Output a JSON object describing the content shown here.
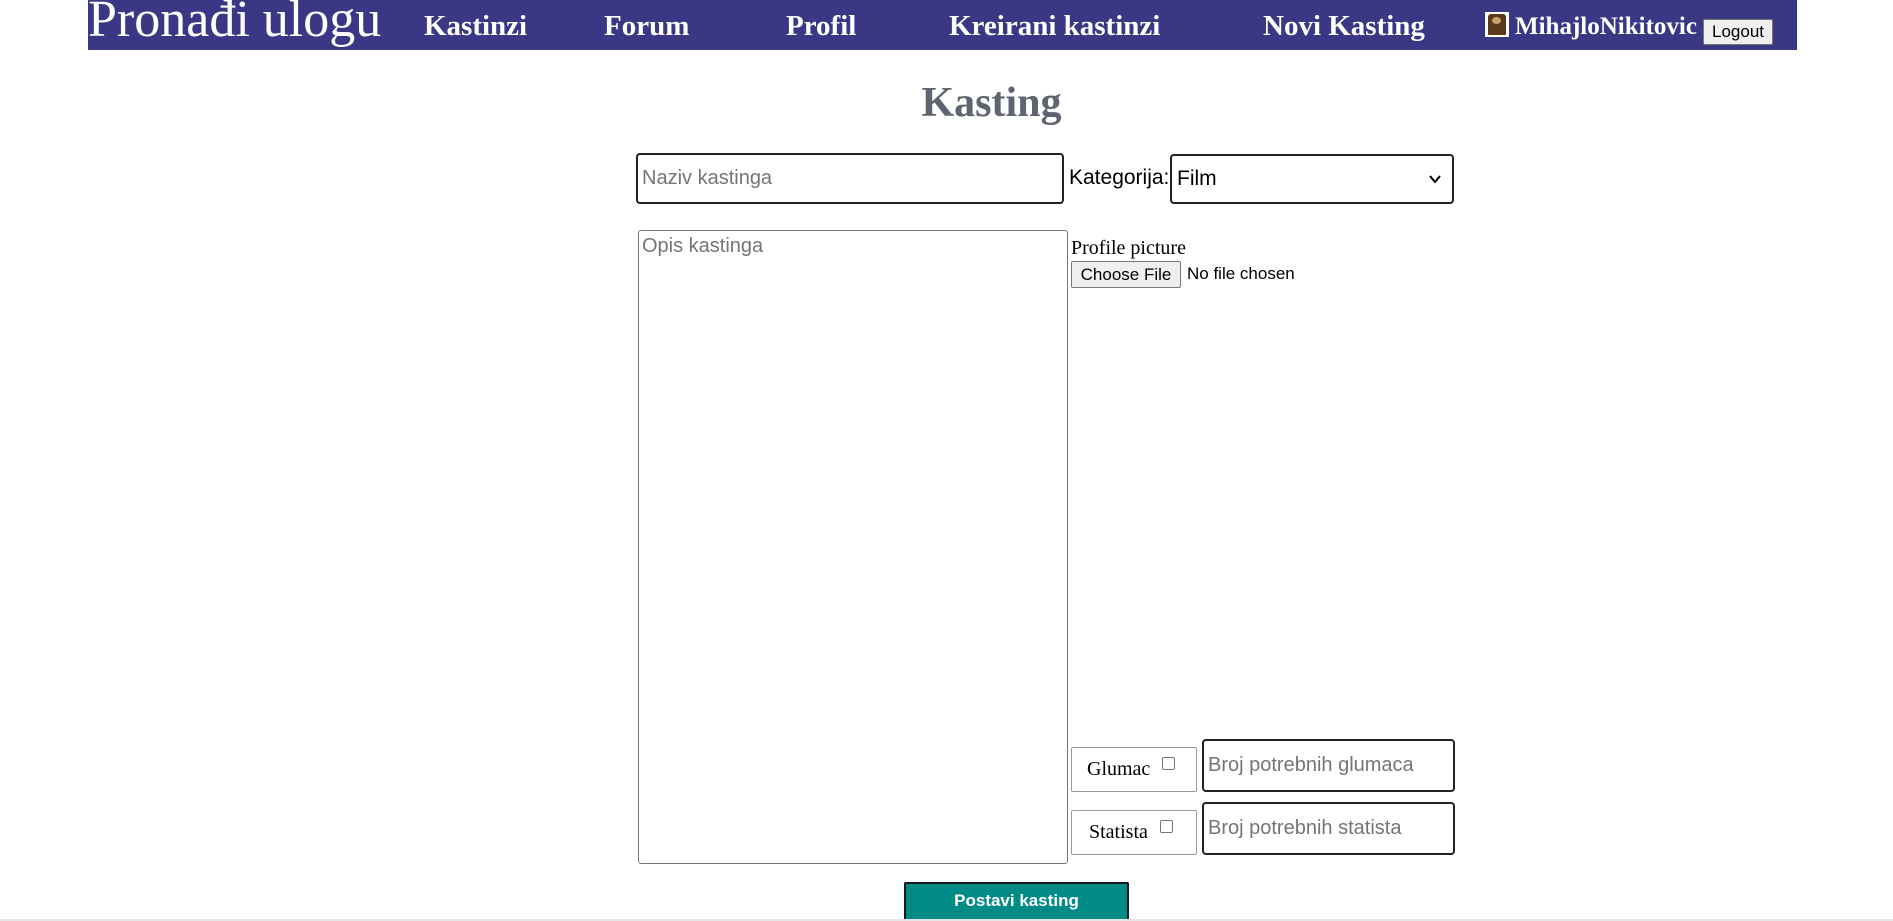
{
  "navbar": {
    "brand": "Pronađi ulogu",
    "links": [
      "Kastinzi",
      "Forum",
      "Profil",
      "Kreirani kastinzi",
      "Novi Kasting"
    ],
    "username": "MihajloNikitovic",
    "logout_label": "Logout",
    "background_color": "#3a3784"
  },
  "form": {
    "title": "Kasting",
    "name_placeholder": "Naziv kastinga",
    "category_label": "Kategorija:",
    "category_selected": "Film",
    "description_placeholder": "Opis kastinga",
    "file_label": "Profile picture",
    "file_button_label": "Choose File",
    "file_status": "No file chosen",
    "actor_label": "Glumac",
    "actor_count_placeholder": "Broj potrebnih glumaca",
    "extra_label": "Statista",
    "extra_count_placeholder": "Broj potrebnih statista",
    "submit_label": "Postavi kasting",
    "submit_color": "#008b87"
  }
}
